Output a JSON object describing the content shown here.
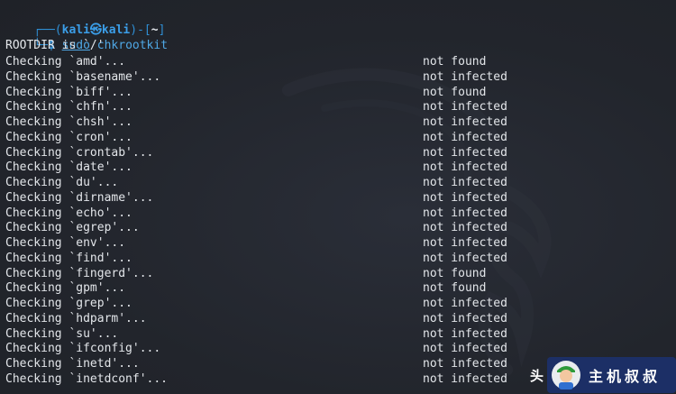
{
  "prompt": {
    "frame_top_left": "┌──(",
    "user": "kali㉿kali",
    "frame_top_mid": ")-[",
    "path": "~",
    "frame_top_right": "]",
    "frame_bottom": "└─",
    "dollar": "$",
    "sudo": "sudo",
    "command": "chkrootkit"
  },
  "rootdir_line": "ROOTDIR is `/'",
  "checks": [
    {
      "label": "Checking `amd'...",
      "status": "not found"
    },
    {
      "label": "Checking `basename'...",
      "status": "not infected"
    },
    {
      "label": "Checking `biff'...",
      "status": "not found"
    },
    {
      "label": "Checking `chfn'...",
      "status": "not infected"
    },
    {
      "label": "Checking `chsh'...",
      "status": "not infected"
    },
    {
      "label": "Checking `cron'...",
      "status": "not infected"
    },
    {
      "label": "Checking `crontab'...",
      "status": "not infected"
    },
    {
      "label": "Checking `date'...",
      "status": "not infected"
    },
    {
      "label": "Checking `du'...",
      "status": "not infected"
    },
    {
      "label": "Checking `dirname'...",
      "status": "not infected"
    },
    {
      "label": "Checking `echo'...",
      "status": "not infected"
    },
    {
      "label": "Checking `egrep'...",
      "status": "not infected"
    },
    {
      "label": "Checking `env'...",
      "status": "not infected"
    },
    {
      "label": "Checking `find'...",
      "status": "not infected"
    },
    {
      "label": "Checking `fingerd'...",
      "status": "not found"
    },
    {
      "label": "Checking `gpm'...",
      "status": "not found"
    },
    {
      "label": "Checking `grep'...",
      "status": "not infected"
    },
    {
      "label": "Checking `hdparm'...",
      "status": "not infected"
    },
    {
      "label": "Checking `su'...",
      "status": "not infected"
    },
    {
      "label": "Checking `ifconfig'...",
      "status": "not infected"
    },
    {
      "label": "Checking `inetd'...",
      "status": "not infected"
    },
    {
      "label": "Checking `inetdconf'...",
      "status": "not infected"
    }
  ],
  "watermark": {
    "head": "头",
    "text": "主机叔叔"
  },
  "colors": {
    "background": "#23262e",
    "prompt_blue": "#3b9ee8",
    "text": "#e3e6ea"
  }
}
